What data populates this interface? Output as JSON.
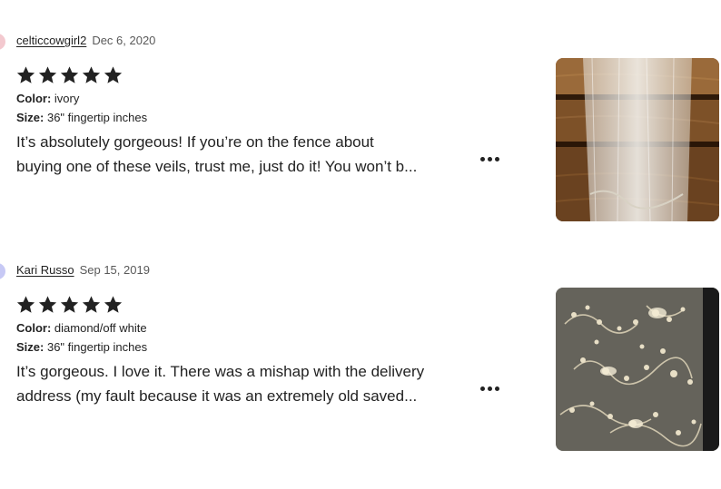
{
  "reviews": [
    {
      "username": "celticcowgirl2",
      "date": "Dec 6, 2020",
      "rating": 5,
      "color_label": "Color:",
      "color_value": "ivory",
      "size_label": "Size:",
      "size_value": "36\" fingertip inches",
      "text_line1": "It’s absolutely gorgeous! If you’re on the fence about",
      "text_line2": "buying one of these veils, trust me, just do it! You won’t b...",
      "avatar_color": "#f3c9cf",
      "photo_icon": "veil-on-wood-photo"
    },
    {
      "username": "Kari Russo",
      "date": "Sep 15, 2019",
      "rating": 5,
      "color_label": "Color:",
      "color_value": "diamond/off white",
      "size_label": "Size:",
      "size_value": "36\" fingertip inches",
      "text_line1": "It’s gorgeous. I love it. There was a mishap with the delivery",
      "text_line2": "address (my fault because it was an extremely old saved...",
      "avatar_color": "#c7c9f5",
      "photo_icon": "beaded-lace-photo"
    }
  ],
  "more_button_icon": "more-dots-icon",
  "star_color": "#222222"
}
